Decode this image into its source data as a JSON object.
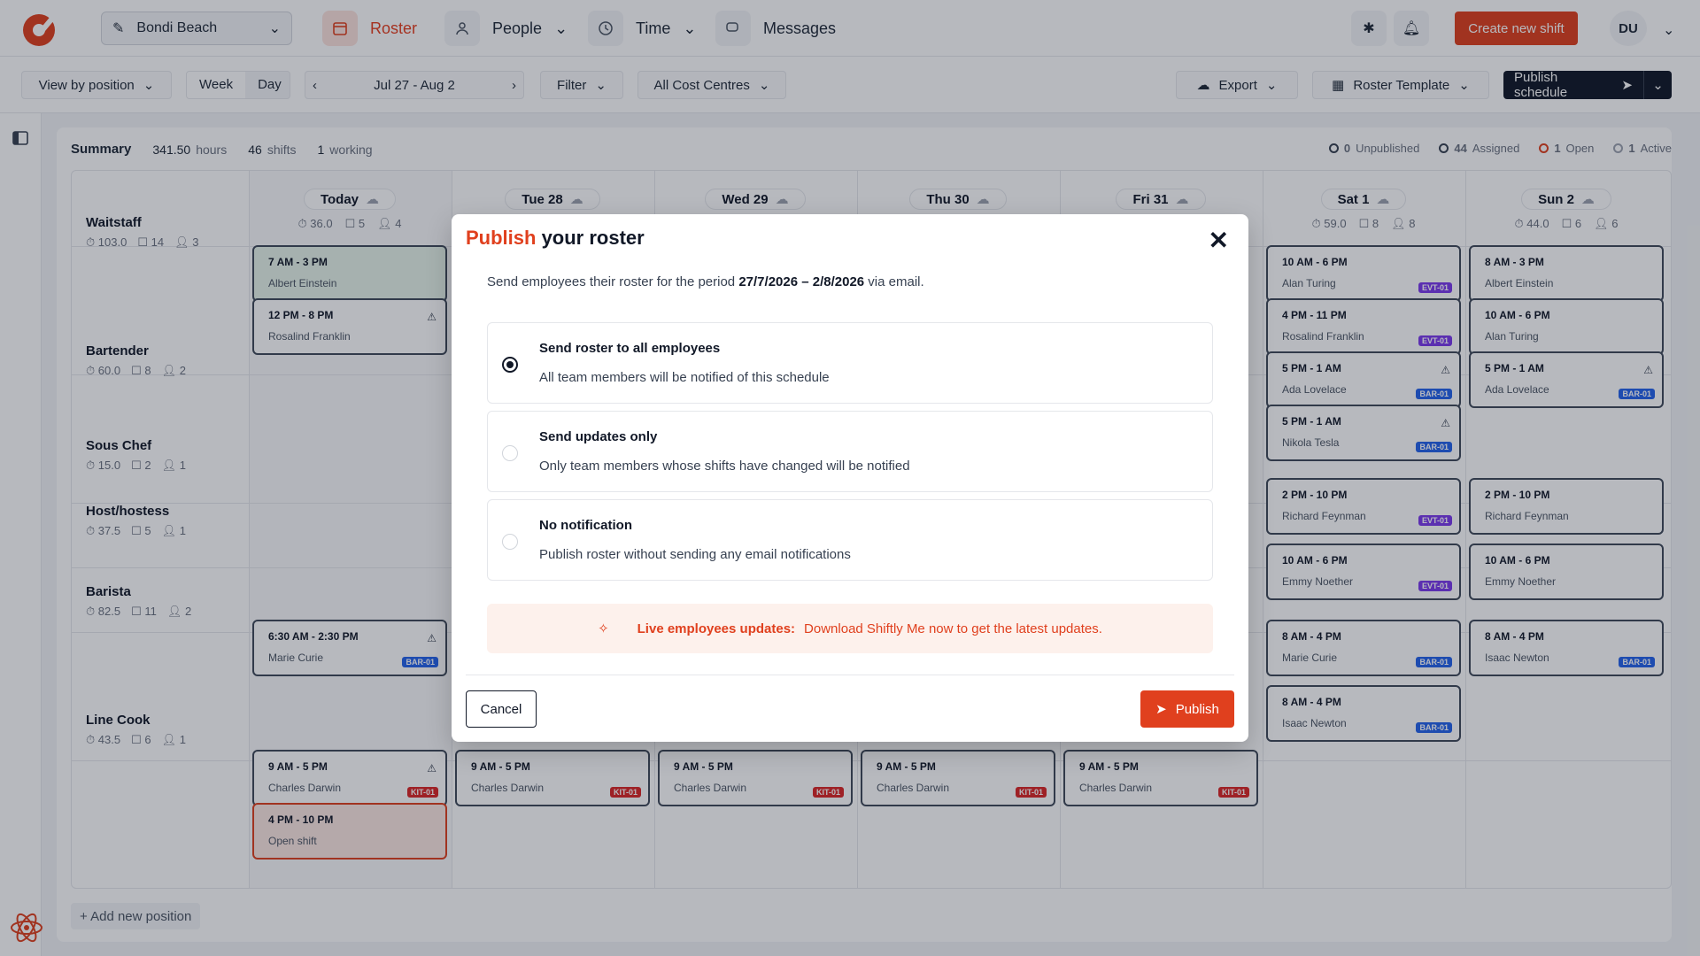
{
  "header": {
    "location": "Bondi Beach",
    "nav": [
      {
        "label": "Roster"
      },
      {
        "label": "People"
      },
      {
        "label": "Time"
      },
      {
        "label": "Messages"
      }
    ],
    "create_label": "Create new shift",
    "avatar_initials": "DU"
  },
  "toolbar": {
    "view_by": "View by position",
    "week": "Week",
    "day": "Day",
    "date_range": "Jul 27 - Aug 2",
    "filter": "Filter",
    "cost_centres": "All Cost Centres",
    "export": "Export",
    "template": "Roster Template",
    "publish_schedule": "Publish schedule"
  },
  "summary": {
    "title": "Summary",
    "hours_value": "341.50",
    "hours_label": "hours",
    "shifts_value": "46",
    "shifts_label": "shifts",
    "working_value": "1",
    "working_label": "working",
    "legend": [
      {
        "value": "0",
        "label": "Unpublished",
        "color": "#374151"
      },
      {
        "value": "44",
        "label": "Assigned",
        "color": "#374151"
      },
      {
        "value": "1",
        "label": "Open",
        "color": "#e0401e"
      },
      {
        "value": "1",
        "label": "Active",
        "color": "#9ca3af"
      }
    ]
  },
  "days": [
    {
      "label": "Today",
      "hours": "36.0",
      "shifts": "5",
      "people": "4"
    },
    {
      "label": "Tue 28",
      "hours": "",
      "shifts": "",
      "people": ""
    },
    {
      "label": "Wed 29",
      "hours": "",
      "shifts": "",
      "people": ""
    },
    {
      "label": "Thu 30",
      "hours": "",
      "shifts": "",
      "people": ""
    },
    {
      "label": "Fri 31",
      "hours": "",
      "shifts": "",
      "people": ""
    },
    {
      "label": "Sat 1",
      "hours": "59.0",
      "shifts": "8",
      "people": "8"
    },
    {
      "label": "Sun 2",
      "hours": "44.0",
      "shifts": "6",
      "people": "6"
    }
  ],
  "positions": [
    {
      "name": "Waitstaff",
      "hours": "103.0",
      "shifts": "14",
      "people": "3"
    },
    {
      "name": "Bartender",
      "hours": "60.0",
      "shifts": "8",
      "people": "2"
    },
    {
      "name": "Sous Chef",
      "hours": "15.0",
      "shifts": "2",
      "people": "1"
    },
    {
      "name": "Host/hostess",
      "hours": "37.5",
      "shifts": "5",
      "people": "1"
    },
    {
      "name": "Barista",
      "hours": "82.5",
      "shifts": "11",
      "people": "2"
    },
    {
      "name": "Line Cook",
      "hours": "43.5",
      "shifts": "6",
      "people": "1"
    }
  ],
  "shifts": [
    {
      "time": "7 AM - 3 PM",
      "person": "Albert Einstein",
      "tag": "",
      "style": "green",
      "warn": false
    },
    {
      "time": "12 PM - 8 PM",
      "person": "Rosalind Franklin",
      "tag": "",
      "style": "",
      "warn": true
    },
    {
      "time": "6:30 AM - 2:30 PM",
      "person": "Marie Curie",
      "tag": "BAR-01",
      "style": "",
      "warn": true
    },
    {
      "time": "9 AM - 5 PM",
      "person": "Charles Darwin",
      "tag": "KIT-01",
      "style": "",
      "warn": true
    },
    {
      "time": "4 PM - 10 PM",
      "person": "Open shift",
      "tag": "",
      "style": "open",
      "warn": false
    },
    {
      "time": "9 AM - 5 PM",
      "person": "Charles Darwin",
      "tag": "KIT-01",
      "style": "",
      "warn": false
    },
    {
      "time": "9 AM - 5 PM",
      "person": "Charles Darwin",
      "tag": "KIT-01",
      "style": "",
      "warn": false
    },
    {
      "time": "9 AM - 5 PM",
      "person": "Charles Darwin",
      "tag": "KIT-01",
      "style": "",
      "warn": false
    },
    {
      "time": "9 AM - 5 PM",
      "person": "Charles Darwin",
      "tag": "KIT-01",
      "style": "",
      "warn": false
    },
    {
      "time": "10 AM - 6 PM",
      "person": "Alan Turing",
      "tag": "EVT-01",
      "style": "",
      "warn": false
    },
    {
      "time": "4 PM - 11 PM",
      "person": "Rosalind Franklin",
      "tag": "EVT-01",
      "style": "",
      "warn": false
    },
    {
      "time": "5 PM - 1 AM",
      "person": "Ada Lovelace",
      "tag": "BAR-01",
      "style": "",
      "warn": true
    },
    {
      "time": "5 PM - 1 AM",
      "person": "Nikola Tesla",
      "tag": "BAR-01",
      "style": "",
      "warn": true
    },
    {
      "time": "2 PM - 10 PM",
      "person": "Richard Feynman",
      "tag": "EVT-01",
      "style": "",
      "warn": false
    },
    {
      "time": "10 AM - 6 PM",
      "person": "Emmy Noether",
      "tag": "EVT-01",
      "style": "",
      "warn": false
    },
    {
      "time": "8 AM - 4 PM",
      "person": "Marie Curie",
      "tag": "BAR-01",
      "style": "",
      "warn": false
    },
    {
      "time": "8 AM - 4 PM",
      "person": "Isaac Newton",
      "tag": "BAR-01",
      "style": "",
      "warn": false
    },
    {
      "time": "8 AM - 3 PM",
      "person": "Albert Einstein",
      "tag": "",
      "style": "",
      "warn": false
    },
    {
      "time": "10 AM - 6 PM",
      "person": "Alan Turing",
      "tag": "",
      "style": "",
      "warn": false
    },
    {
      "time": "5 PM - 1 AM",
      "person": "Ada Lovelace",
      "tag": "BAR-01",
      "style": "",
      "warn": true
    },
    {
      "time": "2 PM - 10 PM",
      "person": "Richard Feynman",
      "tag": "",
      "style": "",
      "warn": false
    },
    {
      "time": "10 AM - 6 PM",
      "person": "Emmy Noether",
      "tag": "",
      "style": "",
      "warn": false
    },
    {
      "time": "8 AM - 4 PM",
      "person": "Isaac Newton",
      "tag": "BAR-01",
      "style": "",
      "warn": false
    }
  ],
  "add_position": "+ Add new position",
  "modal": {
    "title_highlight": "Publish",
    "title_rest": " your roster",
    "close": "✕",
    "desc_prefix": "Send employees their roster for the period ",
    "desc_period": "27/7/2026 – 2/8/2026",
    "desc_suffix": " via email.",
    "options": [
      {
        "title": "Send roster to all employees",
        "desc": "All team members will be notified of this schedule",
        "selected": true
      },
      {
        "title": "Send updates only",
        "desc": "Only team members whose shifts have changed will be notified",
        "selected": false
      },
      {
        "title": "No notification",
        "desc": "Publish roster without sending any email notifications",
        "selected": false
      }
    ],
    "live_label": "Live employees updates:",
    "live_text": "Download Shiftly Me now to get the latest updates.",
    "cancel": "Cancel",
    "publish": "Publish"
  },
  "colors": {
    "accent": "#e0401e",
    "evt": "#7c3aed",
    "bar": "#2563eb",
    "kit": "#dc2626"
  }
}
